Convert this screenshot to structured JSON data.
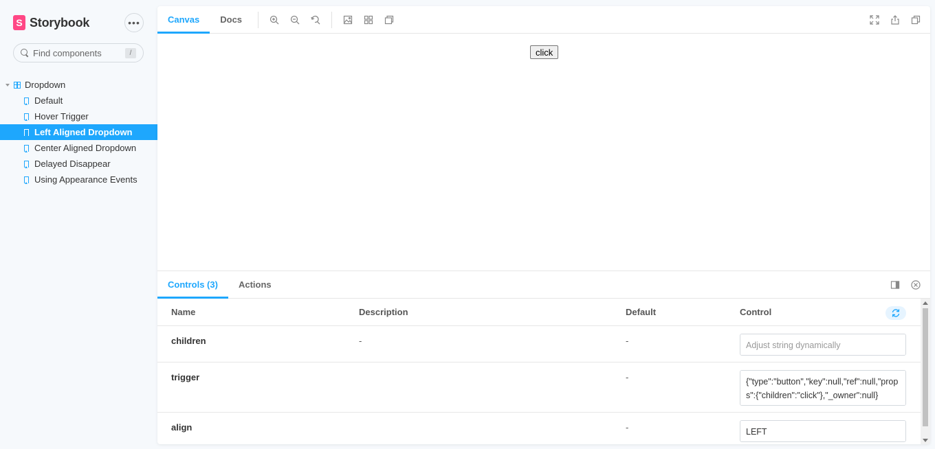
{
  "sidebar": {
    "brand": "Storybook",
    "logo_letter": "S",
    "menu_icon": "ellipsis-icon",
    "search": {
      "placeholder": "Find components",
      "shortcut": "/"
    },
    "root": {
      "label": "Dropdown"
    },
    "stories": [
      {
        "label": "Default",
        "selected": false
      },
      {
        "label": "Hover Trigger",
        "selected": false
      },
      {
        "label": "Left Aligned Dropdown",
        "selected": true
      },
      {
        "label": "Center Aligned Dropdown",
        "selected": false
      },
      {
        "label": "Delayed Disappear",
        "selected": false
      },
      {
        "label": "Using Appearance Events",
        "selected": false
      }
    ]
  },
  "toolbar": {
    "tabs": [
      {
        "label": "Canvas",
        "active": true
      },
      {
        "label": "Docs",
        "active": false
      }
    ],
    "zoom_icons": [
      "zoom-in-icon",
      "zoom-out-icon",
      "zoom-reset-icon"
    ],
    "view_icons": [
      "background-icon",
      "grid-icon",
      "measure-icon"
    ],
    "right_icons": [
      "fullscreen-icon",
      "share-icon",
      "copy-link-icon"
    ]
  },
  "canvas": {
    "button_label": "click"
  },
  "addons": {
    "tabs": [
      {
        "label": "Controls (3)",
        "active": true
      },
      {
        "label": "Actions",
        "active": false
      }
    ],
    "table": {
      "headers": {
        "name": "Name",
        "description": "Description",
        "default": "Default",
        "control": "Control"
      },
      "rows": [
        {
          "name": "children",
          "description": "-",
          "default": "-",
          "control_value": "",
          "control_placeholder": "Adjust string dynamically"
        },
        {
          "name": "trigger",
          "description": "",
          "default": "-",
          "control_value": "{\"type\":\"button\",\"key\":null,\"ref\":null,\"props\":{\"children\":\"click\"},\"_owner\":null}",
          "control_placeholder": ""
        },
        {
          "name": "align",
          "description": "",
          "default": "-",
          "control_value": "LEFT",
          "control_placeholder": ""
        }
      ]
    }
  },
  "colors": {
    "accent": "#1ea7fd",
    "brand": "#ff4785",
    "sidebar_bg": "#f6f9fc"
  }
}
